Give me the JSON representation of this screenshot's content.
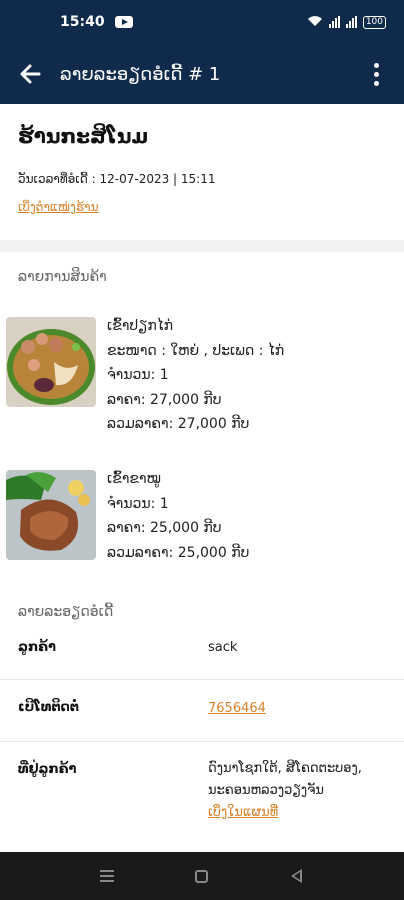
{
  "status_bar": {
    "time": "15:40",
    "battery": "100"
  },
  "app_bar": {
    "title": "ລາຍລະອຽດອໍເດີ້  # 1"
  },
  "shop": {
    "name": "ຮ້ານກະສິໂນມ",
    "order_date": "ວັນເວລາທີ່ອໍເດີ້ : 12-07-2023 | 15:11",
    "map_link": "ເບິ່ງຕຳແໜ່ງຮ້ານ"
  },
  "items_section": {
    "label": "ລາຍການສິນຄ້າ"
  },
  "items": [
    {
      "name": "ເຂົ້າປຽກໄກ່",
      "options": "ຂະໜາດ : ໃຫຍ່ , ປະເພດ : ໄກ່",
      "quantity": "ຈຳນວນ: 1",
      "price": "ລາຄາ: 27,000 ກີບ",
      "total": "ລວມລາຄາ: 27,000 ກີບ",
      "image_icon": "noodle-soup-photo"
    },
    {
      "name": "ເຂົ້າຂາໝູ",
      "quantity": "ຈຳນວນ: 1",
      "price": "ລາຄາ: 25,000 ກີບ",
      "total": "ລວມລາຄາ: 25,000 ກີບ",
      "image_icon": "pork-leg-rice-photo"
    }
  ],
  "order_details": {
    "label": "ລາຍລະອຽດອໍເດີ້",
    "customer_label": "ລູກຄ້າ",
    "customer_value": "sack",
    "phone_label": "ເບີໂທຕິດຕໍ່",
    "phone_value": "7656464",
    "address_label": "ທີ່ຢູ່ລູກຄ້າ",
    "address_value": "ດົງນາໂຊກໃຕ້, ສີໂຄດຕະບອງ, ນະຄອນຫລວງວຽງຈັນ",
    "address_link": "ເບິ່ງໃນແຜນທີ່"
  },
  "colors": {
    "primary": "#0f2a4a",
    "accent": "#d9822b"
  }
}
